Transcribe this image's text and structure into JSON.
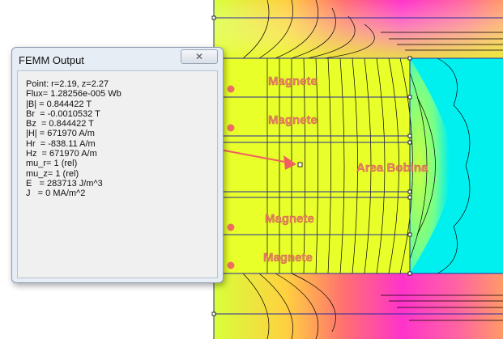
{
  "window": {
    "title": "FEMM Output",
    "close_icon": "close-icon"
  },
  "output_lines": [
    "Point: r=2.19, z=2.27",
    "Flux= 1.28256e-005 Wb",
    "|B| = 0.844422 T",
    "Br  = -0.0010532 T",
    "Bz  = 0.844422 T",
    "|H| = 671970 A/m",
    "Hr  = -838.11 A/m",
    "Hz  = 671970 A/m",
    "mu_r= 1 (rel)",
    "mu_z= 1 (rel)",
    "E   = 283713 J/m^3",
    "J   = 0 MA/m^2"
  ],
  "labels": {
    "magnet_1": "Magnete",
    "magnet_2": "Magnete",
    "magnet_3": "Magnete",
    "magnet_4": "Magnete",
    "coil_area": "Area Bobina"
  },
  "colors": {
    "field_high": "#e8ff2a",
    "field_mid": "#ffcc33",
    "field_pink": "#ff33cc",
    "air": "#00f0f0",
    "arrow": "#f06060",
    "label": "#e8846a"
  }
}
